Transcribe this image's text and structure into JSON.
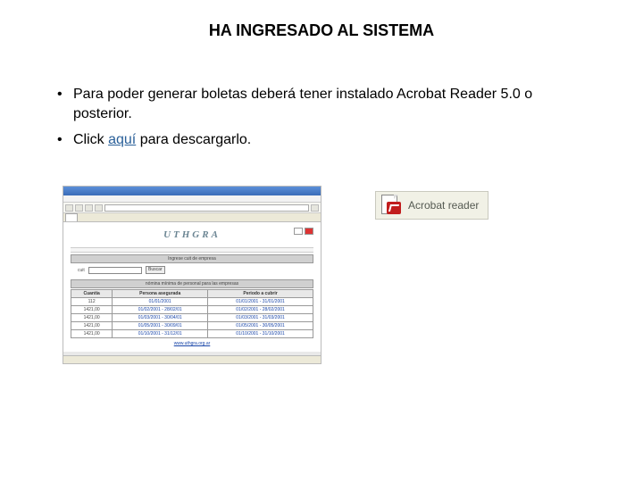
{
  "title": "HA INGRESADO AL SISTEMA",
  "bullets": {
    "b1": "Para poder generar boletas deberá tener instalado Acrobat Reader 5.0 o posterior.",
    "b2_prefix": "Click ",
    "b2_link": "aquí",
    "b2_suffix": " para descargarlo."
  },
  "acrobat": {
    "label": "Acrobat reader"
  },
  "screenshot": {
    "brand": "UTHGRA",
    "panel1": "Ingrese cuit de empresa",
    "search_label": "cuit",
    "search_button": "Buscar",
    "panel2": "nómina mínima de personal para las empresas",
    "table": {
      "headers": [
        "Cuantía",
        "Persona asegurada",
        "Periodo a cubrir"
      ],
      "rows": [
        [
          "112",
          "01/01/2001",
          "01/01/2001 - 31/01/2001"
        ],
        [
          "1421,00",
          "01/02/2001 - 28/02/01",
          "01/02/2001 - 28/02/2001"
        ],
        [
          "1421,00",
          "01/03/2001 - 30/04/01",
          "01/03/2001 - 31/03/2001"
        ],
        [
          "1421,00",
          "01/05/2001 - 30/09/01",
          "01/05/2001 - 30/05/2001"
        ],
        [
          "1421,00",
          "01/10/2001 - 31/12/01",
          "01/10/2001 - 31/10/2001"
        ]
      ]
    },
    "footer_link": "www.uthgra.org.ar"
  }
}
